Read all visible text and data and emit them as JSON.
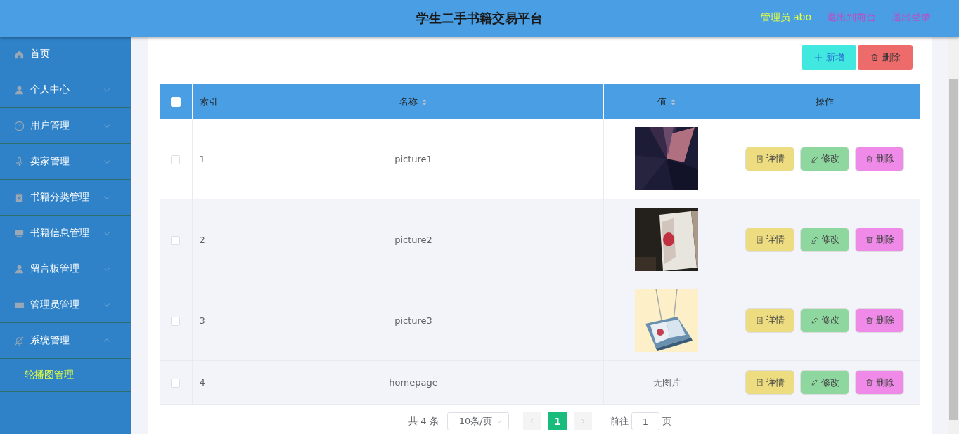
{
  "header": {
    "title": "学生二手书籍交易平台",
    "user": "管理员 abo",
    "links": [
      "退出到前台",
      "退出登录"
    ]
  },
  "sidebar": {
    "items": [
      {
        "label": "首页",
        "kind": "link",
        "selected": false
      },
      {
        "label": "个人中心",
        "kind": "menu",
        "expanded": false,
        "selected": false
      },
      {
        "label": "用户管理",
        "kind": "menu",
        "expanded": false,
        "selected": false
      },
      {
        "label": "卖家管理",
        "kind": "menu",
        "expanded": false,
        "selected": false
      },
      {
        "label": "书籍分类管理",
        "kind": "menu",
        "expanded": false,
        "selected": false
      },
      {
        "label": "书籍信息管理",
        "kind": "menu",
        "expanded": false,
        "selected": false
      },
      {
        "label": "留言板管理",
        "kind": "menu",
        "expanded": false,
        "selected": false
      },
      {
        "label": "管理员管理",
        "kind": "menu",
        "expanded": false,
        "selected": false
      },
      {
        "label": "系统管理",
        "kind": "menu",
        "expanded": true,
        "selected": false,
        "children": [
          {
            "label": "轮播图管理",
            "selected": true
          }
        ]
      }
    ]
  },
  "toolbar": [
    {
      "label": "新增",
      "kind": "add"
    },
    {
      "label": "删除",
      "kind": "delete"
    }
  ],
  "table": {
    "select_all": {
      "checked": false
    },
    "columns": [
      {
        "label": "索引",
        "sortable": false
      },
      {
        "label": "名称",
        "sortable": true
      },
      {
        "label": "值",
        "sortable": true
      },
      {
        "label": "操作",
        "sortable": false
      }
    ],
    "rows": [
      {
        "checked": false,
        "shaded": false,
        "index": "1",
        "name": "picture1",
        "value": {
          "kind": "picture"
        },
        "actions": [
          "详情",
          "修改",
          "删除"
        ]
      },
      {
        "checked": false,
        "shaded": true,
        "index": "2",
        "name": "picture2",
        "value": {
          "kind": "picture"
        },
        "actions": [
          "详情",
          "修改",
          "删除"
        ]
      },
      {
        "checked": false,
        "shaded": true,
        "index": "3",
        "name": "picture3",
        "value": {
          "kind": "picture"
        },
        "actions": [
          "详情",
          "修改",
          "删除"
        ]
      },
      {
        "checked": false,
        "shaded": true,
        "index": "4",
        "name": "homepage",
        "value": {
          "kind": "text",
          "text": "无图片"
        },
        "actions": [
          "详情",
          "修改",
          "删除"
        ]
      }
    ]
  },
  "pagination": {
    "total": "共 4 条",
    "page_size": "10条/页",
    "pages": [
      {
        "label": "1",
        "selected": true
      }
    ],
    "goto_label": "前往",
    "goto_value": "1",
    "goto_suffix": "页"
  }
}
